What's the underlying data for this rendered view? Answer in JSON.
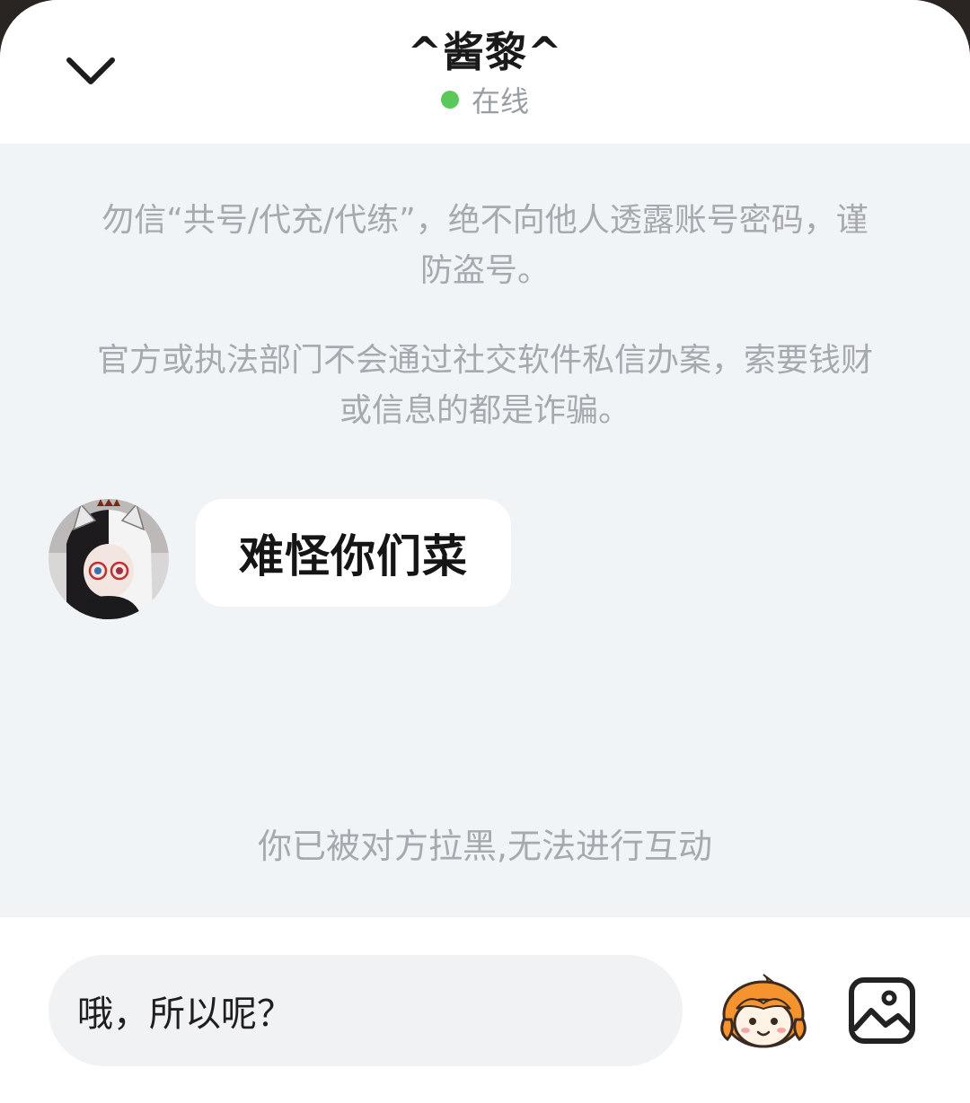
{
  "header": {
    "title": "^酱黎^",
    "status_text": "在线",
    "status_color": "#5ac85a",
    "back_icon": "chevron-down-icon"
  },
  "notices": {
    "account_safety": "勿信“共号/代充/代练”，绝不向他人透露账号密码，谨防盗号。",
    "fraud_warning": "官方或执法部门不会通过社交软件私信办案，索要钱财或信息的都是诈骗。"
  },
  "messages": [
    {
      "sender": "other",
      "avatar_icon": "user-avatar",
      "text": "难怪你们菜"
    }
  ],
  "blocked_notice": "你已被对方拉黑,无法进行互动",
  "input": {
    "value": "哦，所以呢？",
    "emoji_icon": "emoji-mascot-icon",
    "image_icon": "image-icon"
  }
}
